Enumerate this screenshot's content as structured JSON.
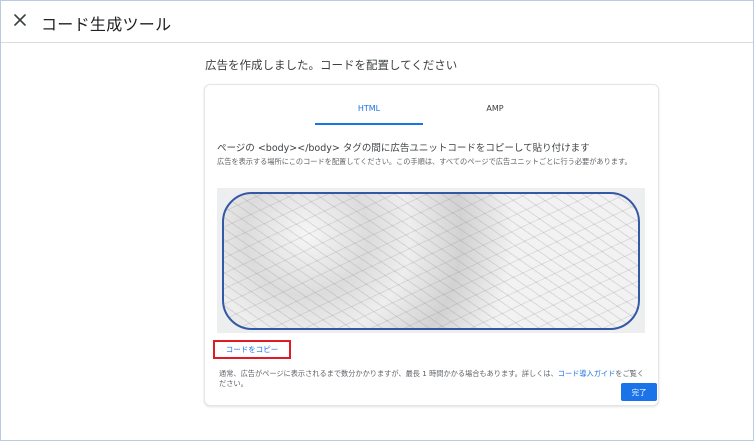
{
  "header": {
    "title": "コード生成ツール",
    "close_icon": "close-icon"
  },
  "main": {
    "heading": "広告を作成しました。コードを配置してください",
    "tabs": [
      {
        "label": "HTML",
        "selected": true
      },
      {
        "label": "AMP",
        "selected": false
      }
    ],
    "instruction": "ページの <body></body> タグの間に広告ユニットコードをコピーして貼り付けます",
    "description": "広告を表示する場所にこのコードを配置してください。この手順は、すべてのページで広告ユニットごとに行う必要があります。",
    "copy_label": "コードをコピー",
    "note_text": "通常、広告がページに表示されるまで数分かかりますが、最長 1 時間かかる場合もあります。詳しくは、",
    "note_link": "コード導入ガイド",
    "note_suffix": "をご覧ください。",
    "done_label": "完了"
  },
  "colors": {
    "accent": "#1a73e8",
    "highlight_border": "#e01b24",
    "code_frame_border": "#3458a6"
  }
}
